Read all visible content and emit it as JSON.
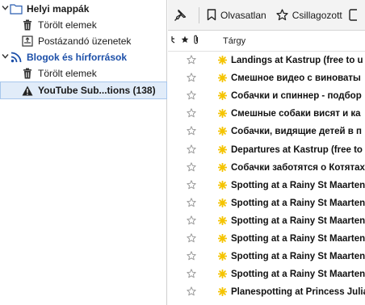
{
  "folders": {
    "local_folders": "Helyi mappák",
    "local_trash": "Törölt elemek",
    "outbox": "Postázandó üzenetek",
    "feeds_account": "Blogok és hírforrások",
    "feeds_trash": "Törölt elemek",
    "youtube_feed": "YouTube Sub...tions (138)"
  },
  "toolbar": {
    "unread_label": "Olvasatlan",
    "starred_label": "Csillagozott"
  },
  "columns": {
    "subject": "Tárgy"
  },
  "messages": [
    "Landings at Kastrup (free to u",
    "Смешное видео с виноваты",
    "Собачки и спиннер - подбор",
    "Смешные собаки висят и ка",
    "Собачки, видящие детей в п",
    "Departures at Kastrup (free to",
    "Собачки заботятся о Котятах",
    "Spotting at a Rainy St Maarten",
    "Spotting at a Rainy St Maarten",
    "Spotting at a Rainy St Maarten",
    "Spotting at a Rainy St Maarten",
    "Spotting at a Rainy St Maarten",
    "Spotting at a Rainy St Maarten",
    "Planespotting at Princess Julia"
  ],
  "colors": {
    "accent_blue": "#1c4fa8",
    "selection_bg": "#e1ecf9",
    "feed_icon": "#f5c400"
  }
}
